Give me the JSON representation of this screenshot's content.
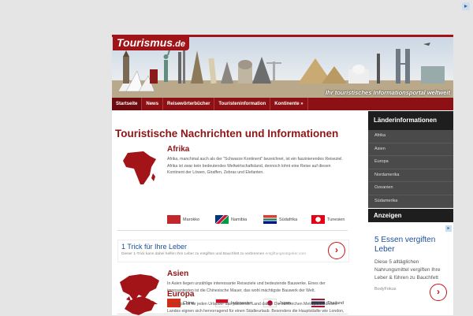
{
  "header": {
    "logo_text": "Tourismus",
    "logo_tld": ".de",
    "tagline": "Ihr touristisches Informationsportal weltweit"
  },
  "nav": {
    "items": [
      "Startseite",
      "News",
      "Reisewörterbücher",
      "Touristeninformation",
      "Kontinente »"
    ]
  },
  "main": {
    "title": "Touristische Nachrichten und Informationen",
    "sections": [
      {
        "title": "Afrika",
        "text": "Afrika, manchmal auch als der \"Schwarze Kontinent\" bezeichnet, ist ein faszinierendes Reiseziel. Afrika ist zwar kein bedeutendes Weltwirtschaftsland, dennoch lohnt eine Reise auf diesen Kontinent der Löwen, Giraffen, Zebras und Elefanten.",
        "countries": [
          "Marokko",
          "Namibia",
          "Südafrika",
          "Tunesien"
        ]
      },
      {
        "title": "Asien",
        "text": "In Asien liegen unzählige interessante Reiseziele und bedeutende Bauwerke. Eines der imposantesten ist die Chinesische Mauer, das wohl mächtigste Bauwerk der Welt.",
        "countries": [
          "China",
          "Indonesien",
          "Japan",
          "Thailand"
        ]
      },
      {
        "title": "Europa",
        "text": "In Europa ist für jeden Urlauber das passende Land dabei. Die zahlreichen Metropolen dieses Landes eignen sich hervorragend für einen Städteurlaub. Besonders die Hauptstädte wie London,"
      }
    ]
  },
  "ad_inline": {
    "title": "1 Trick für Ihre Leber",
    "text": "Dieser 1-Trick kann dabei helfen Ihre Leber zu entgiften und Bauchfett zu verbrennen",
    "domain": "entgiftungsratgeber.com"
  },
  "sidebar": {
    "heading": "Länderinformationen",
    "items": [
      "Afrika",
      "Asien",
      "Europa",
      "Nordamerika",
      "Ozeanien",
      "Südamerika"
    ],
    "ads_heading": "Anzeigen"
  },
  "ad_side": {
    "title": "5 Essen vergiften Leber",
    "text": "Diese 5 alltäglichen Nahrungsmittel vergiften Ihre Leber & führen zu Bauchfett",
    "source": "BodyFokus"
  },
  "colors": {
    "brand_red": "#a01316",
    "title_red": "#8e1516",
    "sidebar_dark": "#1e1e1e",
    "sidebar_item": "#4a4a4a"
  }
}
